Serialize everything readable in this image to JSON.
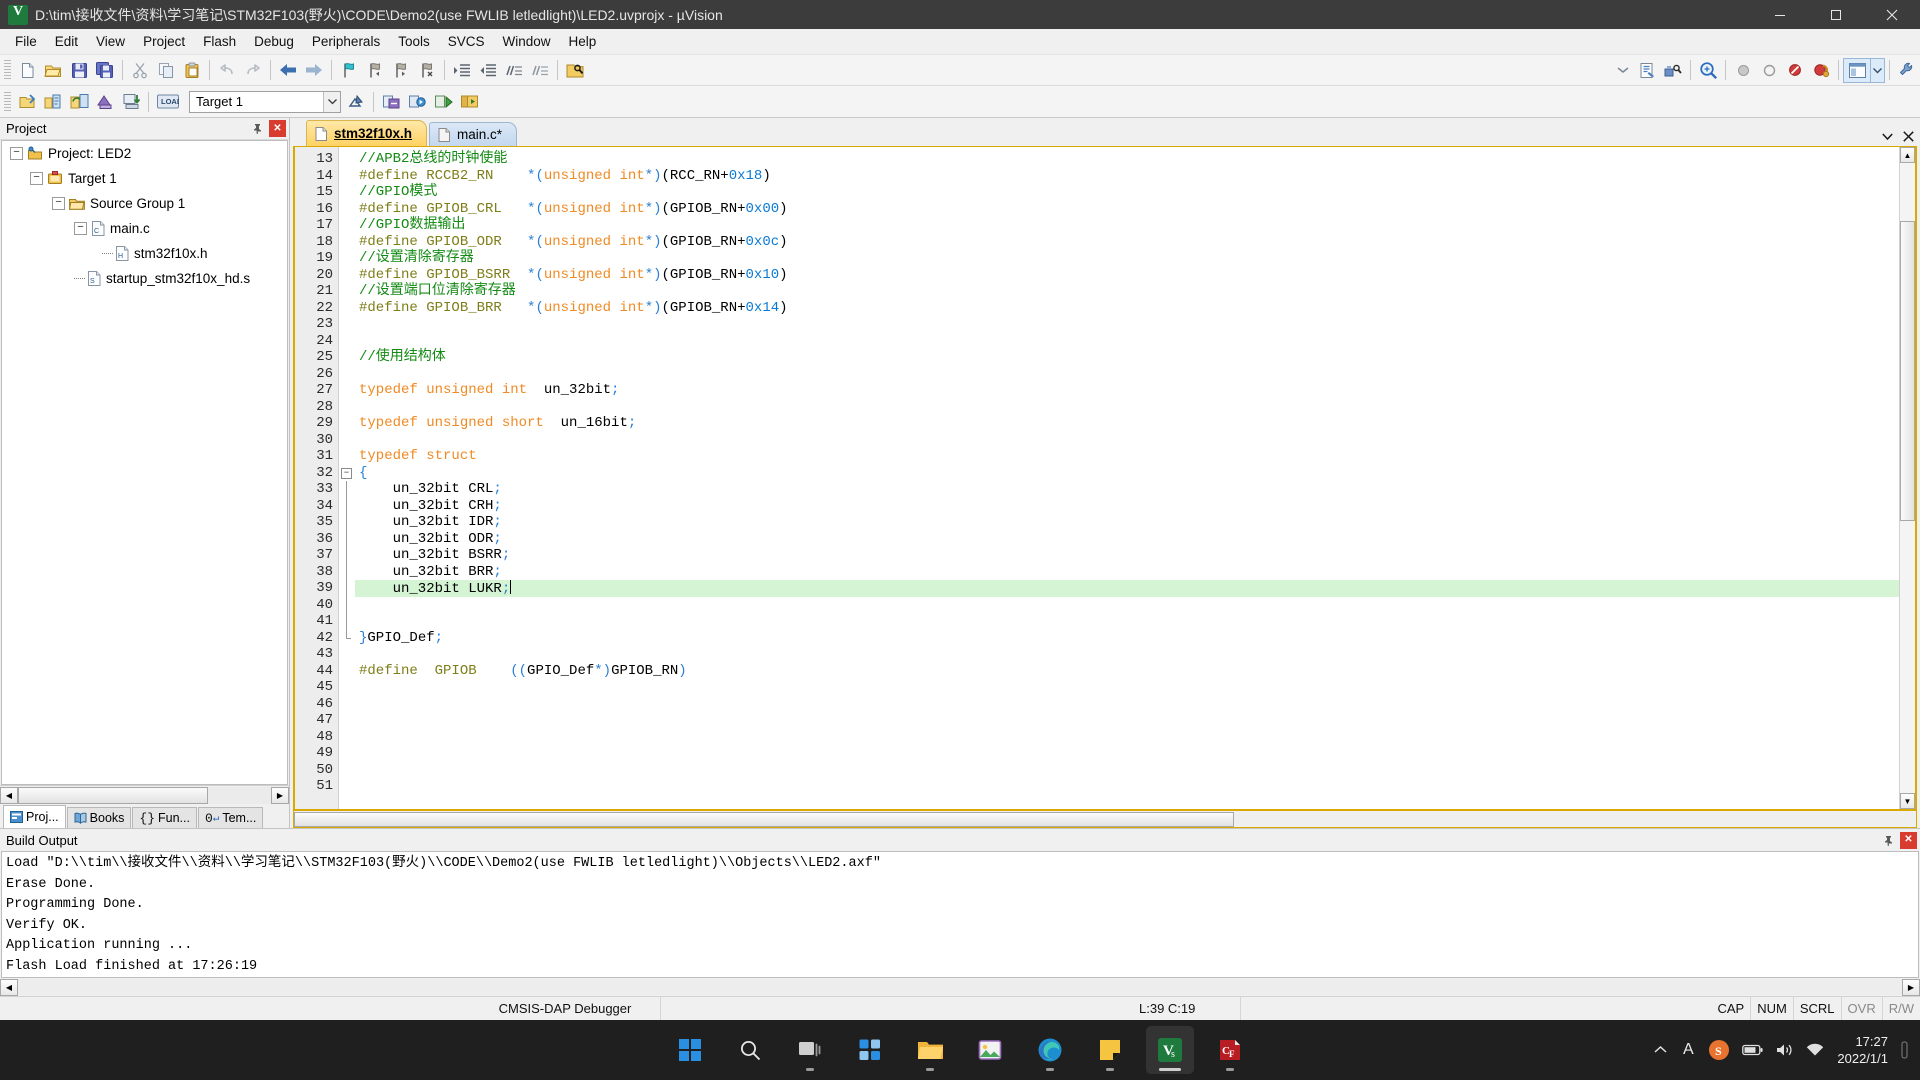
{
  "window": {
    "title": "D:\\tim\\接收文件\\资料\\学习笔记\\STM32F103(野火)\\CODE\\Demo2(use FWLIB letledlight)\\LED2.uvprojx - µVision",
    "app_icon": "uvision-icon",
    "minimize": "—",
    "maximize": "❐",
    "close": "✕"
  },
  "menu": {
    "items": [
      {
        "label": "File"
      },
      {
        "label": "Edit"
      },
      {
        "label": "View"
      },
      {
        "label": "Project"
      },
      {
        "label": "Flash"
      },
      {
        "label": "Debug"
      },
      {
        "label": "Peripherals"
      },
      {
        "label": "Tools"
      },
      {
        "label": "SVCS"
      },
      {
        "label": "Window"
      },
      {
        "label": "Help"
      }
    ]
  },
  "toolbar_main": {
    "buttons": [
      {
        "name": "new-file-icon",
        "title": "New"
      },
      {
        "name": "open-file-icon",
        "title": "Open"
      },
      {
        "name": "save-icon",
        "title": "Save"
      },
      {
        "name": "save-all-icon",
        "title": "Save All"
      },
      {
        "name": "cut-icon",
        "title": "Cut"
      },
      {
        "name": "copy-icon",
        "title": "Copy"
      },
      {
        "name": "paste-icon",
        "title": "Paste"
      },
      {
        "name": "undo-icon",
        "title": "Undo"
      },
      {
        "name": "redo-icon",
        "title": "Redo"
      },
      {
        "name": "navigate-back-icon",
        "title": "Back"
      },
      {
        "name": "navigate-forward-icon",
        "title": "Forward"
      },
      {
        "name": "bookmark-toggle-icon",
        "title": "Insert/Remove Bookmark"
      },
      {
        "name": "bookmark-prev-icon",
        "title": "Previous Bookmark"
      },
      {
        "name": "bookmark-next-icon",
        "title": "Next Bookmark"
      },
      {
        "name": "bookmark-clear-icon",
        "title": "Clear All Bookmarks"
      },
      {
        "name": "indent-icon",
        "title": "Indent"
      },
      {
        "name": "outdent-icon",
        "title": "Outdent"
      },
      {
        "name": "comment-icon",
        "title": "Comment"
      },
      {
        "name": "uncomment-icon",
        "title": "Uncomment"
      },
      {
        "name": "find-in-files-icon",
        "title": "Find in Files"
      }
    ],
    "right_buttons": [
      {
        "name": "combo-dropdown-icon",
        "title": "Find Target"
      },
      {
        "name": "configure-icon",
        "title": "Configure"
      },
      {
        "name": "debug-settings-icon",
        "title": "Debug Settings"
      },
      {
        "name": "zoom-search-icon",
        "title": "Find"
      },
      {
        "name": "breakpoint-icon",
        "title": "Insert Breakpoint"
      },
      {
        "name": "breakpoint-disable-icon",
        "title": "Disable Breakpoint"
      },
      {
        "name": "breakpoint-kill-icon",
        "title": "Kill All Breakpoints"
      },
      {
        "name": "breakpoint-disable-all-icon",
        "title": "Disable All Breakpoints"
      },
      {
        "name": "window-layout-icon",
        "title": "Manage Window"
      },
      {
        "name": "layout-dropdown-icon",
        "title": "Layout Options"
      },
      {
        "name": "configure-target-icon",
        "title": "Configure Target"
      }
    ]
  },
  "toolbar_build": {
    "buttons": [
      {
        "name": "translate-icon",
        "title": "Translate"
      },
      {
        "name": "build-icon",
        "title": "Build"
      },
      {
        "name": "rebuild-icon",
        "title": "Rebuild"
      },
      {
        "name": "batch-build-icon",
        "title": "Batch Build"
      },
      {
        "name": "download-icon",
        "title": "Download"
      },
      {
        "name": "target-options-icon",
        "title": "Options for Target"
      },
      {
        "name": "manage-components-icon",
        "title": "Manage Project Items"
      },
      {
        "name": "pack-installer-icon",
        "title": "Pack Installer"
      },
      {
        "name": "start-debug-icon",
        "title": "Start/Stop Debug Session"
      },
      {
        "name": "run-to-icon",
        "title": "Run"
      },
      {
        "name": "project-window-icon",
        "title": "Project Window"
      }
    ],
    "target_selector": {
      "name": "target-combo",
      "value": "Target 1"
    }
  },
  "project_panel": {
    "title": "Project",
    "pin_icon": "pin-icon",
    "close_icon": "close-icon",
    "tree": [
      {
        "depth": 0,
        "expander": "-",
        "icon": "project-icon",
        "label": "Project: LED2"
      },
      {
        "depth": 1,
        "expander": "-",
        "icon": "target-icon",
        "label": "Target 1"
      },
      {
        "depth": 2,
        "expander": "-",
        "icon": "folder-icon",
        "label": "Source Group 1"
      },
      {
        "depth": 3,
        "expander": "-",
        "icon": "c-file-icon",
        "label": "main.c"
      },
      {
        "depth": 4,
        "expander": "",
        "icon": "h-file-icon",
        "label": "stm32f10x.h"
      },
      {
        "depth": 3,
        "expander": "",
        "icon": "asm-file-icon",
        "label": "startup_stm32f10x_hd.s"
      }
    ],
    "tabs": [
      {
        "label": "Proj...",
        "icon": "project-tab-icon",
        "active": true
      },
      {
        "label": "Books",
        "icon": "books-tab-icon",
        "active": false
      },
      {
        "label": "Fun...",
        "icon": "functions-tab-icon",
        "active": false
      },
      {
        "label": "Tem...",
        "icon": "templates-tab-icon",
        "active": false
      }
    ]
  },
  "editor": {
    "tabs": [
      {
        "label": "stm32f10x.h",
        "active": true,
        "icon": "h-file-icon"
      },
      {
        "label": "main.c*",
        "active": false,
        "icon": "c-file-icon"
      }
    ],
    "tab_controls": [
      {
        "name": "tab-list-dropdown-icon",
        "glyph": "▼"
      },
      {
        "name": "tab-close-icon",
        "glyph": "✕"
      }
    ],
    "first_line_number": 13,
    "current_line": 39,
    "lines": [
      {
        "n": 13,
        "fold": "",
        "tokens": [
          {
            "t": "//APB2总线的时钟使能",
            "c": "com"
          }
        ]
      },
      {
        "n": 14,
        "fold": "",
        "tokens": [
          {
            "t": "#define RCCB2_RN",
            "c": "pre"
          },
          {
            "t": "    ",
            "c": "pl"
          },
          {
            "t": "*",
            "c": "op"
          },
          {
            "t": "(",
            "c": "op"
          },
          {
            "t": "unsigned int",
            "c": "kw"
          },
          {
            "t": "*",
            "c": "op"
          },
          {
            "t": ")",
            "c": "op"
          },
          {
            "t": "(RCC_RN+",
            "c": "pl"
          },
          {
            "t": "0x18",
            "c": "num"
          },
          {
            "t": ")",
            "c": "pl"
          }
        ]
      },
      {
        "n": 15,
        "fold": "",
        "tokens": [
          {
            "t": "//GPIO模式",
            "c": "com"
          }
        ]
      },
      {
        "n": 16,
        "fold": "",
        "tokens": [
          {
            "t": "#define GPIOB_CRL",
            "c": "pre"
          },
          {
            "t": "   ",
            "c": "pl"
          },
          {
            "t": "*",
            "c": "op"
          },
          {
            "t": "(",
            "c": "op"
          },
          {
            "t": "unsigned int",
            "c": "kw"
          },
          {
            "t": "*",
            "c": "op"
          },
          {
            "t": ")",
            "c": "op"
          },
          {
            "t": "(GPIOB_RN+",
            "c": "pl"
          },
          {
            "t": "0x00",
            "c": "num"
          },
          {
            "t": ")",
            "c": "pl"
          }
        ]
      },
      {
        "n": 17,
        "fold": "",
        "tokens": [
          {
            "t": "//GPIO数据输出",
            "c": "com"
          }
        ]
      },
      {
        "n": 18,
        "fold": "",
        "tokens": [
          {
            "t": "#define GPIOB_ODR",
            "c": "pre"
          },
          {
            "t": "   ",
            "c": "pl"
          },
          {
            "t": "*",
            "c": "op"
          },
          {
            "t": "(",
            "c": "op"
          },
          {
            "t": "unsigned int",
            "c": "kw"
          },
          {
            "t": "*",
            "c": "op"
          },
          {
            "t": ")",
            "c": "op"
          },
          {
            "t": "(GPIOB_RN+",
            "c": "pl"
          },
          {
            "t": "0x0c",
            "c": "num"
          },
          {
            "t": ")",
            "c": "pl"
          }
        ]
      },
      {
        "n": 19,
        "fold": "",
        "tokens": [
          {
            "t": "//设置清除寄存器",
            "c": "com"
          }
        ]
      },
      {
        "n": 20,
        "fold": "",
        "tokens": [
          {
            "t": "#define GPIOB_BSRR",
            "c": "pre"
          },
          {
            "t": "  ",
            "c": "pl"
          },
          {
            "t": "*",
            "c": "op"
          },
          {
            "t": "(",
            "c": "op"
          },
          {
            "t": "unsigned int",
            "c": "kw"
          },
          {
            "t": "*",
            "c": "op"
          },
          {
            "t": ")",
            "c": "op"
          },
          {
            "t": "(GPIOB_RN+",
            "c": "pl"
          },
          {
            "t": "0x10",
            "c": "num"
          },
          {
            "t": ")",
            "c": "pl"
          }
        ]
      },
      {
        "n": 21,
        "fold": "",
        "tokens": [
          {
            "t": "//设置端口位清除寄存器",
            "c": "com"
          }
        ]
      },
      {
        "n": 22,
        "fold": "",
        "tokens": [
          {
            "t": "#define GPIOB_BRR",
            "c": "pre"
          },
          {
            "t": "   ",
            "c": "pl"
          },
          {
            "t": "*",
            "c": "op"
          },
          {
            "t": "(",
            "c": "op"
          },
          {
            "t": "unsigned int",
            "c": "kw"
          },
          {
            "t": "*",
            "c": "op"
          },
          {
            "t": ")",
            "c": "op"
          },
          {
            "t": "(GPIOB_RN+",
            "c": "pl"
          },
          {
            "t": "0x14",
            "c": "num"
          },
          {
            "t": ")",
            "c": "pl"
          }
        ]
      },
      {
        "n": 23,
        "fold": "",
        "tokens": []
      },
      {
        "n": 24,
        "fold": "",
        "tokens": []
      },
      {
        "n": 25,
        "fold": "",
        "tokens": [
          {
            "t": "//使用结构体",
            "c": "com"
          }
        ]
      },
      {
        "n": 26,
        "fold": "",
        "tokens": []
      },
      {
        "n": 27,
        "fold": "",
        "tokens": [
          {
            "t": "typedef unsigned int",
            "c": "kw"
          },
          {
            "t": "  un_32bit",
            "c": "pl"
          },
          {
            "t": ";",
            "c": "op"
          }
        ]
      },
      {
        "n": 28,
        "fold": "",
        "tokens": []
      },
      {
        "n": 29,
        "fold": "",
        "tokens": [
          {
            "t": "typedef unsigned short",
            "c": "kw"
          },
          {
            "t": "  un_16bit",
            "c": "pl"
          },
          {
            "t": ";",
            "c": "op"
          }
        ]
      },
      {
        "n": 30,
        "fold": "",
        "tokens": []
      },
      {
        "n": 31,
        "fold": "",
        "tokens": [
          {
            "t": "typedef struct",
            "c": "kw"
          }
        ]
      },
      {
        "n": 32,
        "fold": "-",
        "tokens": [
          {
            "t": "{",
            "c": "op"
          }
        ]
      },
      {
        "n": 33,
        "fold": "|",
        "tokens": [
          {
            "t": "    un_32bit CRL",
            "c": "pl"
          },
          {
            "t": ";",
            "c": "op"
          }
        ]
      },
      {
        "n": 34,
        "fold": "|",
        "tokens": [
          {
            "t": "    un_32bit CRH",
            "c": "pl"
          },
          {
            "t": ";",
            "c": "op"
          }
        ]
      },
      {
        "n": 35,
        "fold": "|",
        "tokens": [
          {
            "t": "    un_32bit IDR",
            "c": "pl"
          },
          {
            "t": ";",
            "c": "op"
          }
        ]
      },
      {
        "n": 36,
        "fold": "|",
        "tokens": [
          {
            "t": "    un_32bit ODR",
            "c": "pl"
          },
          {
            "t": ";",
            "c": "op"
          }
        ]
      },
      {
        "n": 37,
        "fold": "|",
        "tokens": [
          {
            "t": "    un_32bit BSRR",
            "c": "pl"
          },
          {
            "t": ";",
            "c": "op"
          }
        ]
      },
      {
        "n": 38,
        "fold": "|",
        "tokens": [
          {
            "t": "    un_32bit BRR",
            "c": "pl"
          },
          {
            "t": ";",
            "c": "op"
          }
        ]
      },
      {
        "n": 39,
        "fold": "|",
        "tokens": [
          {
            "t": "    un_32bit LUKR",
            "c": "pl"
          },
          {
            "t": ";",
            "c": "op"
          }
        ],
        "current": true,
        "caret": true
      },
      {
        "n": 40,
        "fold": "|",
        "tokens": []
      },
      {
        "n": 41,
        "fold": "|",
        "tokens": []
      },
      {
        "n": 42,
        "fold": "l",
        "tokens": [
          {
            "t": "}",
            "c": "op"
          },
          {
            "t": "GPIO_Def",
            "c": "pl"
          },
          {
            "t": ";",
            "c": "op"
          }
        ]
      },
      {
        "n": 43,
        "fold": "",
        "tokens": []
      },
      {
        "n": 44,
        "fold": "",
        "tokens": [
          {
            "t": "#define  GPIOB",
            "c": "pre"
          },
          {
            "t": "    ",
            "c": "pl"
          },
          {
            "t": "(",
            "c": "op"
          },
          {
            "t": "(",
            "c": "op"
          },
          {
            "t": "GPIO_Def",
            "c": "pl"
          },
          {
            "t": "*",
            "c": "op"
          },
          {
            "t": ")",
            "c": "op"
          },
          {
            "t": "GPIOB_RN",
            "c": "pl"
          },
          {
            "t": ")",
            "c": "op"
          }
        ]
      },
      {
        "n": 45,
        "fold": "",
        "tokens": []
      },
      {
        "n": 46,
        "fold": "",
        "tokens": []
      },
      {
        "n": 47,
        "fold": "",
        "tokens": []
      },
      {
        "n": 48,
        "fold": "",
        "tokens": []
      },
      {
        "n": 49,
        "fold": "",
        "tokens": []
      },
      {
        "n": 50,
        "fold": "",
        "tokens": []
      },
      {
        "n": 51,
        "fold": "",
        "tokens": []
      }
    ]
  },
  "build_output": {
    "title": "Build Output",
    "pin_icon": "pin-icon",
    "close_icon": "close-icon",
    "lines": [
      "Load \"D:\\\\tim\\\\接收文件\\\\资料\\\\学习笔记\\\\STM32F103(野火)\\\\CODE\\\\Demo2(use FWLIB letledlight)\\\\Objects\\\\LED2.axf\"",
      "Erase Done.",
      "Programming Done.",
      "Verify OK.",
      "Application running ...",
      "Flash Load finished at 17:26:19"
    ]
  },
  "statusbar": {
    "debugger": "CMSIS-DAP Debugger",
    "position": "L:39 C:19",
    "indicators": [
      {
        "label": "CAP",
        "dim": false
      },
      {
        "label": "NUM",
        "dim": false
      },
      {
        "label": "SCRL",
        "dim": false
      },
      {
        "label": "OVR",
        "dim": true
      },
      {
        "label": "R/W",
        "dim": true
      }
    ]
  },
  "taskbar": {
    "items": [
      {
        "name": "start-button-icon",
        "label": "Start",
        "active": false
      },
      {
        "name": "search-icon",
        "label": "Search",
        "active": false
      },
      {
        "name": "task-view-icon",
        "label": "Task View",
        "active": false
      },
      {
        "name": "widgets-icon",
        "label": "Widgets",
        "active": false
      },
      {
        "name": "file-explorer-icon",
        "label": "File Explorer",
        "active": false
      },
      {
        "name": "gallery-app-icon",
        "label": "Gallery",
        "active": false
      },
      {
        "name": "edge-browser-icon",
        "label": "Microsoft Edge",
        "active": false
      },
      {
        "name": "sticky-notes-icon",
        "label": "Sticky Notes",
        "active": false
      },
      {
        "name": "uvision-taskbar-icon",
        "label": "µVision",
        "active": true
      },
      {
        "name": "cfree-app-icon",
        "label": "C-Free",
        "active": false
      }
    ],
    "tray": [
      {
        "name": "chevron-up-icon",
        "glyph": "∧"
      },
      {
        "name": "ime-letter-icon",
        "glyph": "A"
      },
      {
        "name": "sogou-ime-icon",
        "glyph": "S"
      },
      {
        "name": "battery-icon",
        "glyph": ""
      },
      {
        "name": "volume-icon",
        "glyph": ""
      },
      {
        "name": "network-icon",
        "glyph": ""
      },
      {
        "name": "action-center-icon",
        "glyph": ""
      }
    ],
    "clock": {
      "time": "17:27",
      "date": "2022/1/1"
    }
  }
}
